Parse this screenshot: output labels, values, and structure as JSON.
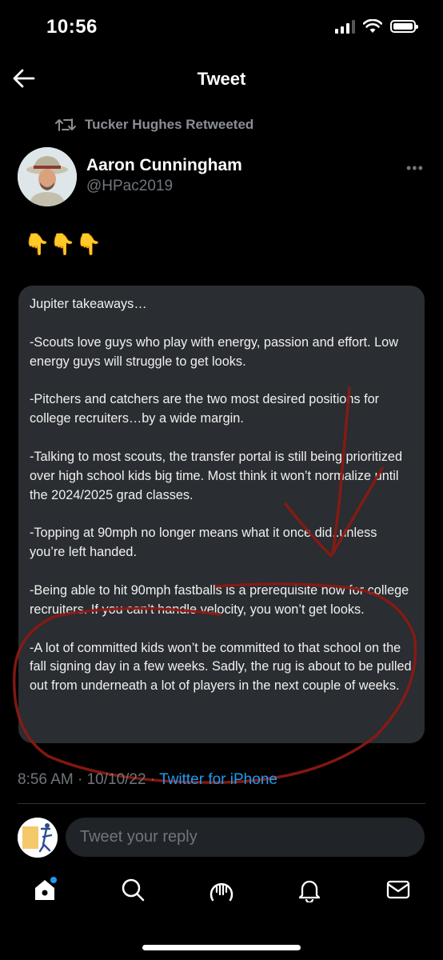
{
  "status": {
    "time": "10:56"
  },
  "header": {
    "title": "Tweet"
  },
  "retweet": {
    "text": "Tucker Hughes Retweeted"
  },
  "author": {
    "name": "Aaron Cunningham",
    "handle": "@HPac2019"
  },
  "emojis": "👇👇👇",
  "card": {
    "paragraphs": [
      "Jupiter takeaways…",
      "-Scouts love guys who play with energy, passion and effort. Low energy guys will struggle to get looks.",
      "-Pitchers and catchers are the two most desired positions for college recruiters…by a wide margin.",
      "-Talking to most scouts, the transfer portal is still being prioritized over high school kids big time. Most think it won’t normalize until the 2024/2025 grad classes.",
      "-Topping at 90mph no longer means what it once did..unless you’re left handed.",
      "-Being able to hit 90mph fastballs is a prerequisite now for college recruiters. If you can’t handle velocity, you won’t get looks.",
      "-A lot of committed kids won’t be committed to that school on the fall signing day in a few weeks. Sadly, the rug is about to be pulled out from underneath a lot of players in the next couple of weeks."
    ]
  },
  "meta": {
    "timestamp": "8:56 AM · 10/10/22 · ",
    "source": "Twitter for iPhone"
  },
  "reply": {
    "placeholder": "Tweet your reply"
  },
  "colors": {
    "accent": "#1d9bf0",
    "annotation": "#8b1a12"
  },
  "nav": [
    "home-icon",
    "search-icon",
    "spaces-icon",
    "notifications-icon",
    "messages-icon"
  ]
}
